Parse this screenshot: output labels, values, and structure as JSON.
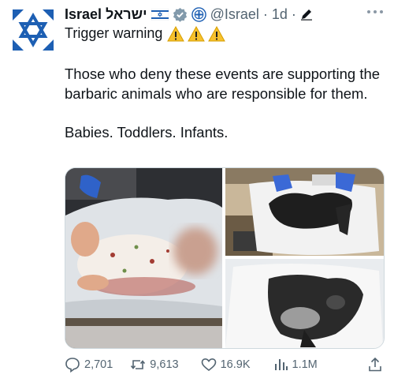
{
  "tweet": {
    "author_name": "Israel",
    "author_name_hebrew": "ישראל",
    "handle": "@Israel",
    "separator": "·",
    "time": "1d",
    "separator2": "·",
    "heading": "Trigger warning",
    "warning_icon": "warning-triangle",
    "body": {
      "paragraph1": "Those who deny these events are supporting the barbaric animals who are responsible for them.",
      "paragraph2": "Babies. Toddlers. Infants."
    },
    "icons": {
      "flag": "israel-flag",
      "verified": "verified-badge",
      "affiliation": "government-emblem",
      "edit": "pencil-icon",
      "avatar": "star-of-david"
    },
    "colors": {
      "brand_blue": "#1d5fb3",
      "verified_gray": "#829aab",
      "text": "#0f1419",
      "secondary": "#536471"
    }
  },
  "actions": {
    "replies": "2,701",
    "retweets": "9,613",
    "likes": "16.9K",
    "views": "1.1M"
  }
}
